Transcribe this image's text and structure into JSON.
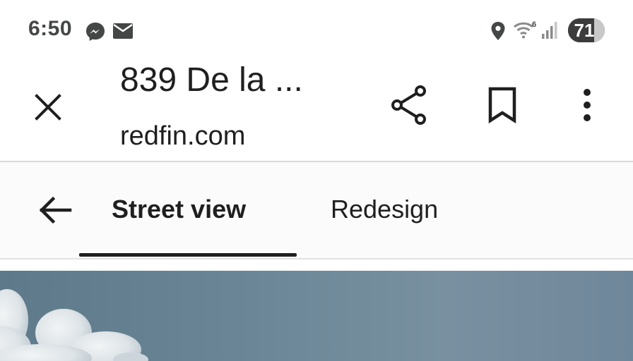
{
  "status_bar": {
    "time": "6:50",
    "notification_icons": [
      "messenger-icon",
      "gmail-icon"
    ],
    "system_icons": [
      "location-icon",
      "wifi-6-icon",
      "signal-icon"
    ],
    "wifi_label": "6",
    "battery_level": "71"
  },
  "browser": {
    "page_title": "839 De la ...",
    "domain": "redfin.com",
    "actions": [
      "close-icon",
      "share-icon",
      "bookmark-icon",
      "more-icon"
    ]
  },
  "tabs": {
    "items": [
      {
        "label": "Street view",
        "active": true
      },
      {
        "label": "Redesign",
        "active": false
      }
    ]
  },
  "colors": {
    "text": "#1f1f1f",
    "status_text": "#444746",
    "battery_badge": "#3c3c3c",
    "sky": "#6b8797"
  }
}
